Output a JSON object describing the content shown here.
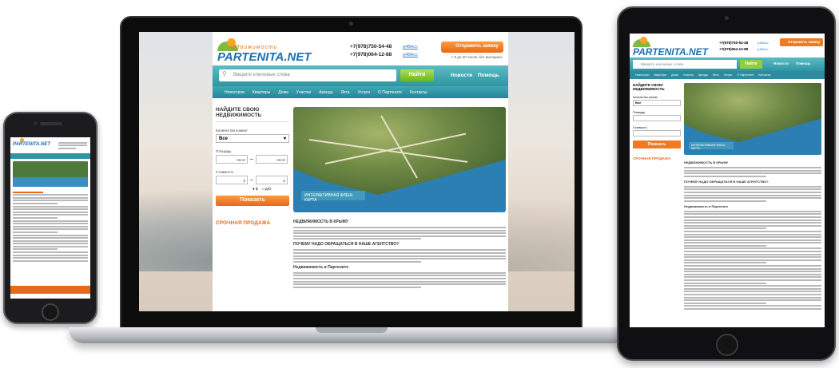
{
  "site": {
    "logo_tagline": "недвижимость",
    "logo_name": "PARTENITA.NET",
    "phone_1": "+7(978)750-54-48",
    "phone_2": "+7(978)064-12-88",
    "skype_1": "р4ВАсс",
    "skype_2": "р4ВАсс",
    "send_request": "Отправить заявку",
    "work_time": "с 8 до 20 часов, без выходных"
  },
  "search": {
    "placeholder": "Введите ключевые слова",
    "button": "Найти",
    "news": "Новости",
    "help": "Помощь"
  },
  "menu": [
    "Новострои",
    "Квартиры",
    "Дома",
    "Участки",
    "Аренда",
    "Яхта",
    "Услуги",
    "О Партените",
    "Контакты"
  ],
  "filter": {
    "title": "НАЙДИТЕ СВОЮ НЕДВИЖИМОСТЬ",
    "rooms_label": "Количество комнат",
    "rooms_value": "Все",
    "area_label": "Площадь",
    "area_unit": "КВ.М",
    "price_label": "Стоимость",
    "currency_1": "$",
    "currency_2": "руб.",
    "show_button": "Показать",
    "hot_sale": "СРОЧНАЯ ПРОДАЖА"
  },
  "map": {
    "label": "ИНТЕРАКТИВНАЯ ФЛЕШ-КАРТА"
  },
  "content": {
    "h1": "НЕДВИЖИМОСТЬ В КРЫМУ",
    "h2": "ПОЧЕМУ НАДО ОБРАЩАТЬСЯ В НАШЕ АГЕНТСТВО?",
    "h3": "Недвижимость в Партените"
  },
  "colors": {
    "brand_blue": "#1d6fb2",
    "accent_orange": "#e8681a",
    "teal": "#2f95a3",
    "green": "#7dbb3c"
  }
}
